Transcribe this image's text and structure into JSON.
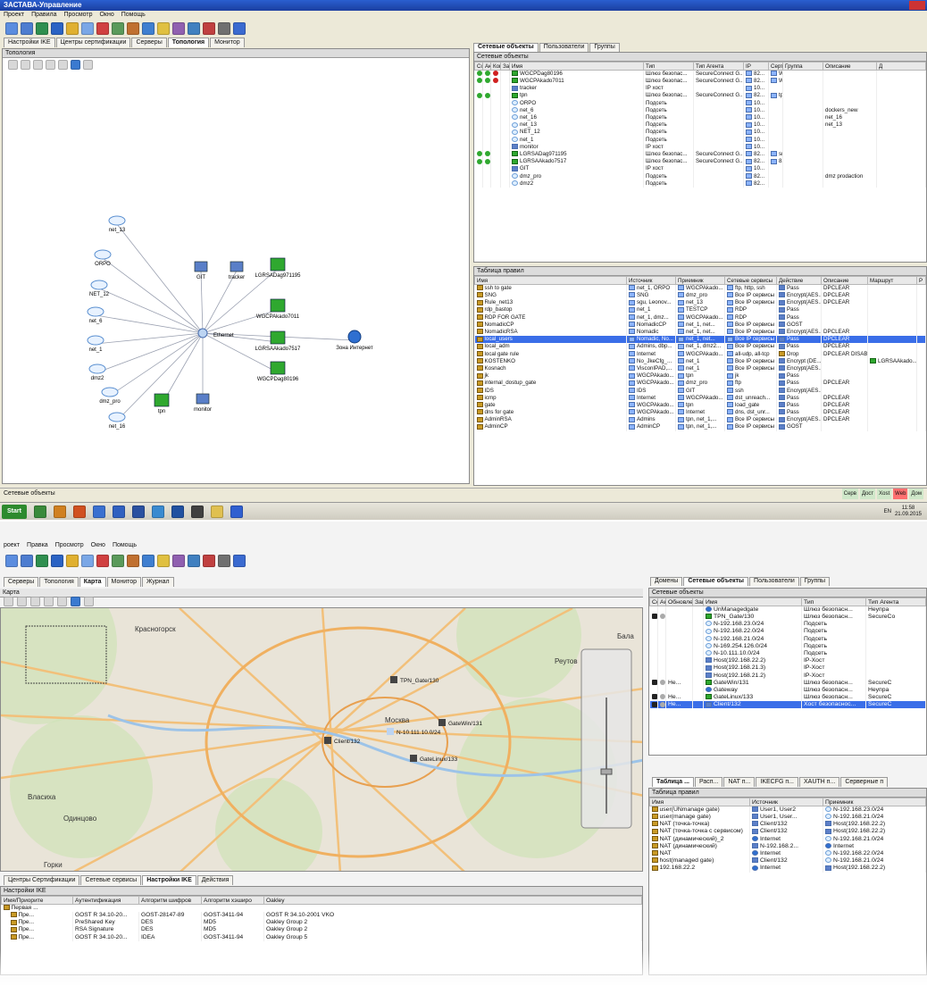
{
  "top": {
    "app_title": "ЗАСТАВА-Управление",
    "menu": [
      "Проект",
      "Правила",
      "Просмотр",
      "Окно",
      "Помощь"
    ],
    "main_tabs": [
      "Настройки IKE",
      "Центры сертификации",
      "Серверы",
      "Топология",
      "Монитор"
    ],
    "active_main_tab": "Топология",
    "topology_header": "Топология",
    "right_tabs": [
      "Сетевые объекты",
      "Пользователи",
      "Группы"
    ],
    "objects_header": "Сетевые объекты",
    "objects_columns": [
      "Сох",
      "Акт",
      "Конт",
      "Заин",
      "Имя",
      "Тип",
      "Тип Агента",
      "IP",
      "Сертифи",
      "Группа",
      "Описание",
      "Д"
    ],
    "objects": [
      {
        "status": "ggr",
        "name": "WGCPDag80196",
        "type": "Шлюз безопас...",
        "agent": "SecureConnect G...",
        "ip": "82...",
        "cert": "WG...",
        "group": "",
        "desc": "",
        "icon": "gw"
      },
      {
        "status": "ggr",
        "name": "WGCPAkado7011",
        "type": "Шлюз безопас...",
        "agent": "SecureConnect G...",
        "ip": "82...",
        "cert": "WG...",
        "group": "",
        "desc": "",
        "icon": "gw"
      },
      {
        "status": "",
        "name": "tracker",
        "type": "IP хост",
        "agent": "",
        "ip": "10...",
        "cert": "",
        "group": "",
        "desc": "",
        "icon": "host"
      },
      {
        "status": "gg",
        "name": "tpn",
        "type": "Шлюз безопас...",
        "agent": "SecureConnect G...",
        "ip": "82...",
        "cert": "tpn...",
        "group": "",
        "desc": "",
        "icon": "gw"
      },
      {
        "status": "",
        "name": "ORPO",
        "type": "Подсеть",
        "agent": "",
        "ip": "10...",
        "cert": "",
        "group": "",
        "desc": "",
        "icon": "cloud"
      },
      {
        "status": "",
        "name": "net_6",
        "type": "Подсеть",
        "agent": "",
        "ip": "10...",
        "cert": "",
        "group": "",
        "desc": "dockers_new",
        "icon": "cloud"
      },
      {
        "status": "",
        "name": "net_16",
        "type": "Подсеть",
        "agent": "",
        "ip": "10...",
        "cert": "",
        "group": "",
        "desc": "net_16",
        "icon": "cloud"
      },
      {
        "status": "",
        "name": "net_13",
        "type": "Подсеть",
        "agent": "",
        "ip": "10...",
        "cert": "",
        "group": "",
        "desc": "net_13",
        "icon": "cloud"
      },
      {
        "status": "",
        "name": "NET_12",
        "type": "Подсеть",
        "agent": "",
        "ip": "10...",
        "cert": "",
        "group": "",
        "desc": "",
        "icon": "cloud"
      },
      {
        "status": "",
        "name": "net_1",
        "type": "Подсеть",
        "agent": "",
        "ip": "10...",
        "cert": "",
        "group": "",
        "desc": "",
        "icon": "cloud"
      },
      {
        "status": "",
        "name": "monitor",
        "type": "IP хост",
        "agent": "",
        "ip": "10...",
        "cert": "",
        "group": "",
        "desc": "",
        "icon": "host"
      },
      {
        "status": "gg",
        "name": "LGRSADag971195",
        "type": "Шлюз безопас...",
        "agent": "SecureConnect G...",
        "ip": "82...",
        "cert": "sma...",
        "group": "",
        "desc": "",
        "icon": "gw"
      },
      {
        "status": "gg",
        "name": "LGRSAAkado7517",
        "type": "Шлюз безопас...",
        "agent": "SecureConnect G...",
        "ip": "82...",
        "cert": "82...",
        "group": "",
        "desc": "",
        "icon": "gw"
      },
      {
        "status": "",
        "name": "GIT",
        "type": "IP хост",
        "agent": "",
        "ip": "10...",
        "cert": "",
        "group": "",
        "desc": "",
        "icon": "host"
      },
      {
        "status": "",
        "name": "dmz_pro",
        "type": "Подсеть",
        "agent": "",
        "ip": "82...",
        "cert": "",
        "group": "",
        "desc": "dmz prodaction",
        "icon": "cloud"
      },
      {
        "status": "",
        "name": "dmz2",
        "type": "Подсеть",
        "agent": "",
        "ip": "82...",
        "cert": "",
        "group": "",
        "desc": "",
        "icon": "cloud"
      }
    ],
    "rules_header": "Таблица правил",
    "rules_columns": [
      "Имя",
      "Источник",
      "Приемник",
      "Сетевые сервисы",
      "Действие",
      "Описание",
      "Маршрут",
      "Р"
    ],
    "rules": [
      {
        "name": "ssh to gate",
        "src": "net_1, ORPO",
        "dst": "WGCPAkado...",
        "svc": "ftp, http, ssh",
        "act": "Pass",
        "desc": "DPCLEAR",
        "route": "",
        "sel": false
      },
      {
        "name": "SNG",
        "src": "SNG",
        "dst": "dmz_pro",
        "svc": "Все IP сервисы",
        "act": "Encrypt(AES...",
        "desc": "DPCLEAR",
        "route": "",
        "sel": false
      },
      {
        "name": "Rule_net13",
        "src": "sgu, Leonov...",
        "dst": "net_13",
        "svc": "Все IP сервисы",
        "act": "Encrypt(AES...",
        "desc": "DPCLEAR",
        "route": "",
        "sel": false
      },
      {
        "name": "rdp_bastop",
        "src": "net_1",
        "dst": "TESTCP",
        "svc": "RDP",
        "act": "Pass",
        "desc": "",
        "route": "",
        "sel": false
      },
      {
        "name": "RDP FOR GATE",
        "src": "net_1, dmz...",
        "dst": "WGCPAkado...",
        "svc": "RDP",
        "act": "Pass",
        "desc": "",
        "route": "",
        "sel": false
      },
      {
        "name": "NomadicCP",
        "src": "NomadicCP",
        "dst": "net_1, net...",
        "svc": "Все IP сервисы",
        "act": "GOST",
        "desc": "",
        "route": "",
        "sel": false
      },
      {
        "name": "NomadicRSA",
        "src": "Nomadic",
        "dst": "net_1, net...",
        "svc": "Все IP сервисы",
        "act": "Encrypt(AES...",
        "desc": "DPCLEAR",
        "route": "",
        "sel": false
      },
      {
        "name": "local_users",
        "src": "Nomadic, No...",
        "dst": "net_1, net...",
        "svc": "Все IP сервисы",
        "act": "Pass",
        "desc": "DPCLEAR",
        "route": "",
        "sel": true
      },
      {
        "name": "local_adm",
        "src": "Admins, dbp...",
        "dst": "net_1, dmz2...",
        "svc": "Все IP сервисы",
        "act": "Pass",
        "desc": "DPCLEAR",
        "route": "",
        "sel": false
      },
      {
        "name": "local gate rule",
        "src": "Internet",
        "dst": "WGCPAkado...",
        "svc": "all-udp, all-tcp",
        "act": "Drop",
        "desc": "DPCLEAR DISABL...",
        "route": "",
        "sel": false
      },
      {
        "name": "KOSTENKO",
        "src": "No_JkeCfg_...",
        "dst": "net_1",
        "svc": "Все IP сервисы",
        "act": "Encrypt (DE...",
        "desc": "",
        "route": "LGRSAAkado...",
        "sel": false
      },
      {
        "name": "Kosnach",
        "src": "VisconIPAD,...",
        "dst": "net_1",
        "svc": "Все IP сервисы",
        "act": "Encrypt(AES...",
        "desc": "",
        "route": "",
        "sel": false
      },
      {
        "name": "jk",
        "src": "WGCPAkado...",
        "dst": "tpn",
        "svc": "jk",
        "act": "Pass",
        "desc": "",
        "route": "",
        "sel": false
      },
      {
        "name": "internal_dostup_gate",
        "src": "WGCPAkado...",
        "dst": "dmz_pro",
        "svc": "ftp",
        "act": "Pass",
        "desc": "DPCLEAR",
        "route": "",
        "sel": false
      },
      {
        "name": "IDS",
        "src": "IDS",
        "dst": "GIT",
        "svc": "ssh",
        "act": "Encrypt(AES...",
        "desc": "",
        "route": "",
        "sel": false
      },
      {
        "name": "icmp",
        "src": "Internet",
        "dst": "WGCPAkado...",
        "svc": "dst_unreach...",
        "act": "Pass",
        "desc": "DPCLEAR",
        "route": "",
        "sel": false
      },
      {
        "name": "gate",
        "src": "WGCPAkado...",
        "dst": "tpn",
        "svc": "load_gate",
        "act": "Pass",
        "desc": "DPCLEAR",
        "route": "",
        "sel": false
      },
      {
        "name": "dns for gate",
        "src": "WGCPAkado...",
        "dst": "Internet",
        "svc": "dns, dst_unr...",
        "act": "Pass",
        "desc": "DPCLEAR",
        "route": "",
        "sel": false
      },
      {
        "name": "AdminRSA",
        "src": "Admins",
        "dst": "tpn, net_1,...",
        "svc": "Все IP сервисы",
        "act": "Encrypt(AES...",
        "desc": "DPCLEAR",
        "route": "",
        "sel": false
      },
      {
        "name": "AdminCP",
        "src": "AdminCP",
        "dst": "tpn, net_1,...",
        "svc": "Все IP сервисы",
        "act": "GOST",
        "desc": "",
        "route": "",
        "sel": false
      }
    ],
    "status_text": "Сетевые объекты",
    "status_right": [
      "Серв",
      "Дост",
      "Xost",
      "Web",
      "Дом"
    ],
    "start_label": "Start",
    "tray_lang": "EN",
    "clock_time": "11:58",
    "clock_date": "21.09.2015",
    "topology_nodes": {
      "ethernet": "Ethernet",
      "internet": "Зона Интернет",
      "clouds": [
        "net_13",
        "ORPO",
        "NET_12",
        "net_6",
        "net_1",
        "dmz2",
        "dmz_pro",
        "net_16"
      ],
      "hosts": [
        "GIT",
        "tracker",
        "monitor"
      ],
      "gateways": [
        "LGRSADag971195",
        "WGCPAkado7011",
        "LGRSAAkado7517",
        "WGCPDag80196",
        "tpn"
      ]
    }
  },
  "bottom": {
    "menu": [
      "роект",
      "Правка",
      "Просмотр",
      "Окно",
      "Помощь"
    ],
    "main_tabs": [
      "Серверы",
      "Топология",
      "Карта",
      "Монитор",
      "Журнал"
    ],
    "active_main_tab": "Карта",
    "map_header": "Карта",
    "map_labels": {
      "city": "Москва",
      "krasnogorsk": "Красногорск",
      "reutov": "Реутов",
      "balashikha": "Бала",
      "odintsovo": "Одинцово",
      "vlasikha": "Власиха",
      "gorki": "Горки",
      "nodes": [
        "TPN_Gate/130",
        "N-10.111.10.0/24",
        "Client/132",
        "GateWin/131",
        "GateLinux/133"
      ]
    },
    "right_tabs": [
      "Домены",
      "Сетевые объекты",
      "Пользователи",
      "Группы"
    ],
    "active_right_tab": "Сетевые объекты",
    "objects_header": "Сетевые объекты",
    "objects_columns": [
      "Сох",
      "Акт",
      "Обновлен",
      "Заин",
      "Имя",
      "Тип",
      "Тип Агента"
    ],
    "objects": [
      {
        "st": "",
        "upd": "",
        "name": "UnManagedgate",
        "type": "Шлюз безопасн...",
        "agent": "Неупра",
        "icon": "globe"
      },
      {
        "st": "k",
        "upd": "",
        "name": "TPN_Gate/130",
        "type": "Шлюз безопасн...",
        "agent": "SecureCo",
        "icon": "gw"
      },
      {
        "st": "",
        "upd": "",
        "name": "N-192.168.23.0/24",
        "type": "Подсеть",
        "agent": "",
        "icon": "cloud"
      },
      {
        "st": "",
        "upd": "",
        "name": "N-192.168.22.0/24",
        "type": "Подсеть",
        "agent": "",
        "icon": "cloud"
      },
      {
        "st": "",
        "upd": "",
        "name": "N-192.168.21.0/24",
        "type": "Подсеть",
        "agent": "",
        "icon": "cloud"
      },
      {
        "st": "",
        "upd": "",
        "name": "N-169.254.126.0/24",
        "type": "Подсеть",
        "agent": "",
        "icon": "cloud"
      },
      {
        "st": "",
        "upd": "",
        "name": "N-10.111.10.0/24",
        "type": "Подсеть",
        "agent": "",
        "icon": "cloud"
      },
      {
        "st": "",
        "upd": "",
        "name": "Host(192.168.22.2)",
        "type": "IP-Хост",
        "agent": "",
        "icon": "host"
      },
      {
        "st": "",
        "upd": "",
        "name": "Host(192.168.21.3)",
        "type": "IP-Хост",
        "agent": "",
        "icon": "host"
      },
      {
        "st": "",
        "upd": "",
        "name": "Host(192.168.21.2)",
        "type": "IP-Хост",
        "agent": "",
        "icon": "host"
      },
      {
        "st": "k",
        "upd": "He...",
        "name": "GateWin/131",
        "type": "Шлюз безопасн...",
        "agent": "SecureC",
        "icon": "gw"
      },
      {
        "st": "",
        "upd": "",
        "name": "Gateway",
        "type": "Шлюз безопасн...",
        "agent": "Неупра",
        "icon": "globe"
      },
      {
        "st": "k",
        "upd": "He...",
        "name": "GateLinux/133",
        "type": "Шлюз безопасн...",
        "agent": "SecureC",
        "icon": "gw"
      },
      {
        "st": "k",
        "upd": "He...",
        "name": "Client/132",
        "type": "Хост безопаснос...",
        "agent": "SecureC",
        "icon": "host",
        "sel": true
      }
    ],
    "lower_right_tabs": [
      "Таблица ...",
      "Расп...",
      "NAT п...",
      "IKECFG п...",
      "XAUTH п...",
      "Серверные п"
    ],
    "rules_header": "Таблица правил",
    "rules_columns": [
      "Имя",
      "Источник",
      "Приемник"
    ],
    "rules": [
      {
        "name": "user(UNmanage gate)",
        "src": "User1, User2",
        "dst": "N-192.168.23.0/24"
      },
      {
        "name": "user(manage gate)",
        "src": "User1, User...",
        "dst": "N-192.168.21.0/24"
      },
      {
        "name": "NAT (точка-точка)",
        "src": "Client/132",
        "dst": "Host(192.168.22.2)"
      },
      {
        "name": "NAT (точка-точка с сервисом)",
        "src": "Client/132",
        "dst": "Host(192.168.22.2)"
      },
      {
        "name": "NAT (динамический)_2",
        "src": "Internet",
        "dst": "N-192.168.21.0/24"
      },
      {
        "name": "NAT (динамический)",
        "src": "N-192.168.2...",
        "dst": "Internet"
      },
      {
        "name": "NAT",
        "src": "Internet",
        "dst": "N-192.168.22.0/24"
      },
      {
        "name": "host(managed gate)",
        "src": "Client/132",
        "dst": "N-192.168.21.0/24"
      },
      {
        "name": "192.168.22.2",
        "src": "Internet",
        "dst": "Host(192.168.22.2)"
      }
    ],
    "lower_tabs": [
      "Центры Сертификации",
      "Сетевые сервисы",
      "Настройки IKE",
      "Действия"
    ],
    "active_lower_tab": "Настройки IKE",
    "ike_header": "Настройки IKE",
    "ike_columns": [
      "Имя/Приорите",
      "Аутентификация",
      "Алгоритм шифров",
      "Алгоритм хэширо",
      "Oakley"
    ],
    "ike_group": "Первая ...",
    "ike_rows": [
      {
        "name": "Пре...",
        "auth": "GOST R 34.10-20...",
        "enc": "GOST-28147-89",
        "hash": "GOST-3411-94",
        "oakley": "GOST R 34.10-2001 VKO"
      },
      {
        "name": "Пре...",
        "auth": "PreShared Key",
        "enc": "DES",
        "hash": "MD5",
        "oakley": "Oakley Group 2"
      },
      {
        "name": "Пре...",
        "auth": "RSA Signature",
        "enc": "DES",
        "hash": "MD5",
        "oakley": "Oakley Group 2"
      },
      {
        "name": "Пре...",
        "auth": "GOST R 34.10-20...",
        "enc": "IDEA",
        "hash": "GOST-3411-94",
        "oakley": "Oakley Group 5"
      }
    ]
  },
  "colors": {
    "selection": "#3a6ee8",
    "gateway_green": "#2fa82f",
    "status_red": "#d02020",
    "map_bg": "#e9e4d8"
  }
}
